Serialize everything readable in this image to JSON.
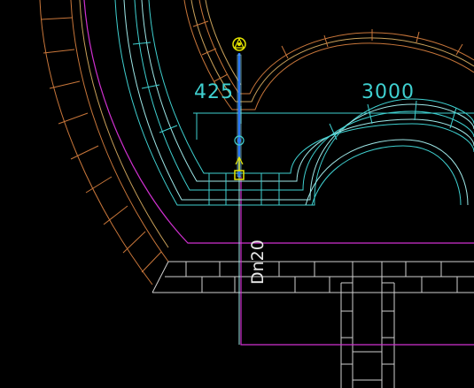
{
  "drawing": {
    "background": "#000000",
    "colors": {
      "wall_orange": "#c8763a",
      "wall_tan": "#c9a15a",
      "cyan": "#3fd0d0",
      "cyan_light": "#9fe8e8",
      "magenta": "#d030d0",
      "gray_white": "#d8d8d8",
      "yellow": "#e6e600",
      "blue": "#2878ff"
    }
  },
  "dimensions": {
    "left_value": "425",
    "right_value": "3000"
  },
  "pipe": {
    "label": "Dn20"
  }
}
